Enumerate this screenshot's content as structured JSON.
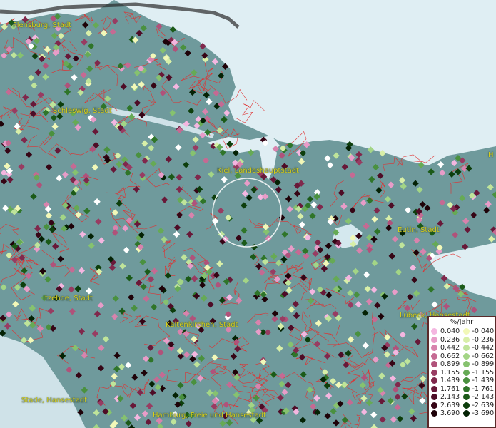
{
  "map": {
    "colors": {
      "land": "#6f9a9c",
      "sea": "#dfeef3",
      "borders": "#e03030",
      "label": "#d8d020"
    },
    "cities": [
      {
        "id": "flensburg",
        "name": "Flensburg, Stadt"
      },
      {
        "id": "schleswig",
        "name": "Schleswig, Stadt"
      },
      {
        "id": "kiel",
        "name": "Kiel, Landeshauptstadt"
      },
      {
        "id": "eutin",
        "name": "Eutin, Stadt"
      },
      {
        "id": "itzehoe",
        "name": "Itzehoe, Stadt"
      },
      {
        "id": "kaltenkirchen",
        "name": "Kaltenkirchen, Stadt"
      },
      {
        "id": "luebeck",
        "name": "Lübeck, Hansestadt"
      },
      {
        "id": "stade",
        "name": "Stade, Hansestadt"
      },
      {
        "id": "hamburg",
        "name": "Hamburg, Freie und Hansestadt"
      },
      {
        "id": "h-partial",
        "name": "H"
      }
    ]
  },
  "legend": {
    "title": "%/Jahr",
    "positive": [
      {
        "label": "0.040",
        "color": "#f4b6e0"
      },
      {
        "label": "0.236",
        "color": "#e89cc8"
      },
      {
        "label": "0.442",
        "color": "#d883ad"
      },
      {
        "label": "0.662",
        "color": "#c56a93"
      },
      {
        "label": "0.899",
        "color": "#b0527a"
      },
      {
        "label": "1.155",
        "color": "#983c62"
      },
      {
        "label": "1.439",
        "color": "#80284c"
      },
      {
        "label": "1.761",
        "color": "#681838"
      },
      {
        "label": "2.143",
        "color": "#4e0c26"
      },
      {
        "label": "2.639",
        "color": "#360515"
      },
      {
        "label": "3.690",
        "color": "#1e0208"
      }
    ],
    "negative": [
      {
        "label": "-0.040",
        "color": "#f2f8b8"
      },
      {
        "label": "-0.236",
        "color": "#d8efa8"
      },
      {
        "label": "-0.442",
        "color": "#bfe49a"
      },
      {
        "label": "-0.662",
        "color": "#a3d586"
      },
      {
        "label": "-0.899",
        "color": "#86c26f"
      },
      {
        "label": "-1.155",
        "color": "#66aa55"
      },
      {
        "label": "-1.439",
        "color": "#4a913f"
      },
      {
        "label": "-1.761",
        "color": "#2f7529"
      },
      {
        "label": "-2.143",
        "color": "#1b5a18"
      },
      {
        "label": "-2.639",
        "color": "#0d3e0c"
      },
      {
        "label": "-3.690",
        "color": "#042204"
      }
    ]
  }
}
